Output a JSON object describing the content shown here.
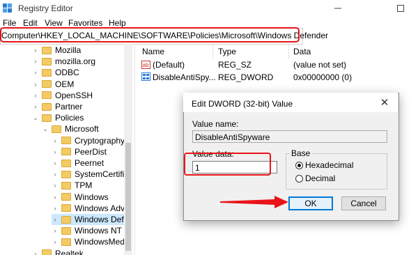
{
  "window": {
    "title": "Registry Editor"
  },
  "menu": [
    "File",
    "Edit",
    "View",
    "Favorites",
    "Help"
  ],
  "address": {
    "path": "Computer\\HKEY_LOCAL_MACHINE\\SOFTWARE\\Policies\\Microsoft\\Windows Defender"
  },
  "tree": {
    "items": [
      {
        "label": "Mozilla",
        "indent": 2,
        "expanded": false
      },
      {
        "label": "mozilla.org",
        "indent": 2,
        "expanded": false
      },
      {
        "label": "ODBC",
        "indent": 2,
        "expanded": false
      },
      {
        "label": "OEM",
        "indent": 2,
        "expanded": false
      },
      {
        "label": "OpenSSH",
        "indent": 2,
        "expanded": false
      },
      {
        "label": "Partner",
        "indent": 2,
        "expanded": false
      },
      {
        "label": "Policies",
        "indent": 2,
        "expanded": true
      },
      {
        "label": "Microsoft",
        "indent": 3,
        "expanded": true
      },
      {
        "label": "Cryptography",
        "indent": 4,
        "expanded": false
      },
      {
        "label": "PeerDist",
        "indent": 4,
        "expanded": false
      },
      {
        "label": "Peernet",
        "indent": 4,
        "expanded": false
      },
      {
        "label": "SystemCertific",
        "indent": 4,
        "expanded": false
      },
      {
        "label": "TPM",
        "indent": 4,
        "expanded": false
      },
      {
        "label": "Windows",
        "indent": 4,
        "expanded": false
      },
      {
        "label": "Windows Adva",
        "indent": 4,
        "expanded": false
      },
      {
        "label": "Windows Defe",
        "indent": 4,
        "expanded": false,
        "selected": true
      },
      {
        "label": "Windows NT",
        "indent": 4,
        "expanded": false
      },
      {
        "label": "WindowsMedi",
        "indent": 4,
        "expanded": false
      },
      {
        "label": "Realtek",
        "indent": 2,
        "expanded": false
      }
    ]
  },
  "list": {
    "headers": {
      "name": "Name",
      "type": "Type",
      "data": "Data"
    },
    "rows": [
      {
        "name": "(Default)",
        "type": "REG_SZ",
        "data": "(value not set)",
        "icon": "string-value-icon"
      },
      {
        "name": "DisableAntiSpy...",
        "type": "REG_DWORD",
        "data": "0x00000000 (0)",
        "icon": "dword-value-icon"
      }
    ]
  },
  "dialog": {
    "title": "Edit DWORD (32-bit) Value",
    "value_name_label": "Value name:",
    "value_name": "DisableAntiSpyware",
    "value_data_label": "Value data:",
    "value_data": "1",
    "base_label": "Base",
    "radio_hex": "Hexadecimal",
    "radio_dec": "Decimal",
    "base_selected": "Hexadecimal",
    "ok": "OK",
    "cancel": "Cancel"
  },
  "colors": {
    "highlight": "#e8141a",
    "accent": "#0078d7",
    "folder": "#f3cb63",
    "selection": "#cce8ff"
  }
}
